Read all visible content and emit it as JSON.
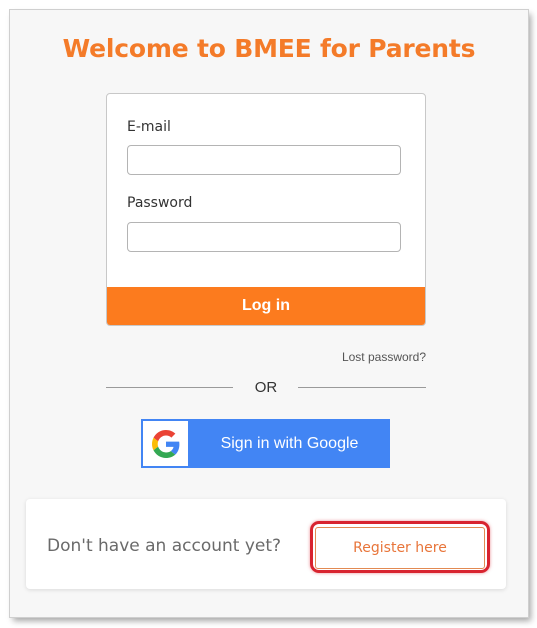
{
  "header": {
    "title": "Welcome to BMEE for Parents"
  },
  "login_form": {
    "email_label": "E-mail",
    "email_value": "",
    "password_label": "Password",
    "password_value": "",
    "login_button": "Log in"
  },
  "lost_password_link": "Lost password?",
  "divider": {
    "text": "OR"
  },
  "google": {
    "button_label": "Sign in with Google",
    "icon": "google-g-icon"
  },
  "register": {
    "prompt": "Don't have an account yet?",
    "button_label": "Register here"
  },
  "colors": {
    "accent": "#f47b29",
    "login_button": "#fc7b1e",
    "google_blue": "#4285f4",
    "highlight": "#d8242f"
  }
}
